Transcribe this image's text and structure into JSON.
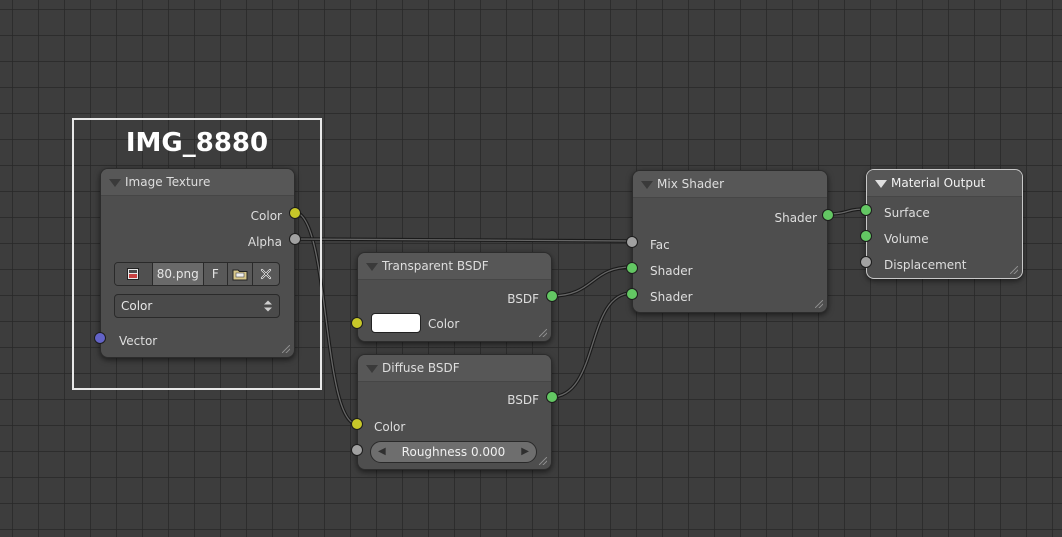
{
  "frame": {
    "title": "IMG_8880"
  },
  "nodes": {
    "image_texture": {
      "title": "Image Texture",
      "outputs": [
        "Color",
        "Alpha"
      ],
      "image_name": "80.png",
      "fake_user_label": "F",
      "color_space": "Color",
      "inputs": [
        "Vector"
      ]
    },
    "transparent_bsdf": {
      "title": "Transparent BSDF",
      "output": "BSDF",
      "color_label": "Color",
      "color_value": "#ffffff"
    },
    "diffuse_bsdf": {
      "title": "Diffuse BSDF",
      "output": "BSDF",
      "color_label": "Color",
      "roughness": "Roughness 0.000"
    },
    "mix_shader": {
      "title": "Mix Shader",
      "output": "Shader",
      "inputs": [
        "Fac",
        "Shader",
        "Shader"
      ]
    },
    "material_output": {
      "title": "Material Output",
      "inputs": [
        "Surface",
        "Volume",
        "Displacement"
      ]
    }
  },
  "icons": {
    "image_browse": "image-icon",
    "open_file": "folder-icon",
    "unlink": "close-icon",
    "collapse": "triangle-down-icon",
    "dropdown": "updown-arrows-icon"
  },
  "colors": {
    "background": "#3d3d3d",
    "node_body": "#4e4e4e",
    "socket_color": "#c7c729",
    "socket_shader": "#63c763",
    "socket_vector": "#6363c7",
    "socket_float": "#a1a1a1",
    "wire": "#1e1e1e",
    "frame_border": "#e8e8e8"
  }
}
